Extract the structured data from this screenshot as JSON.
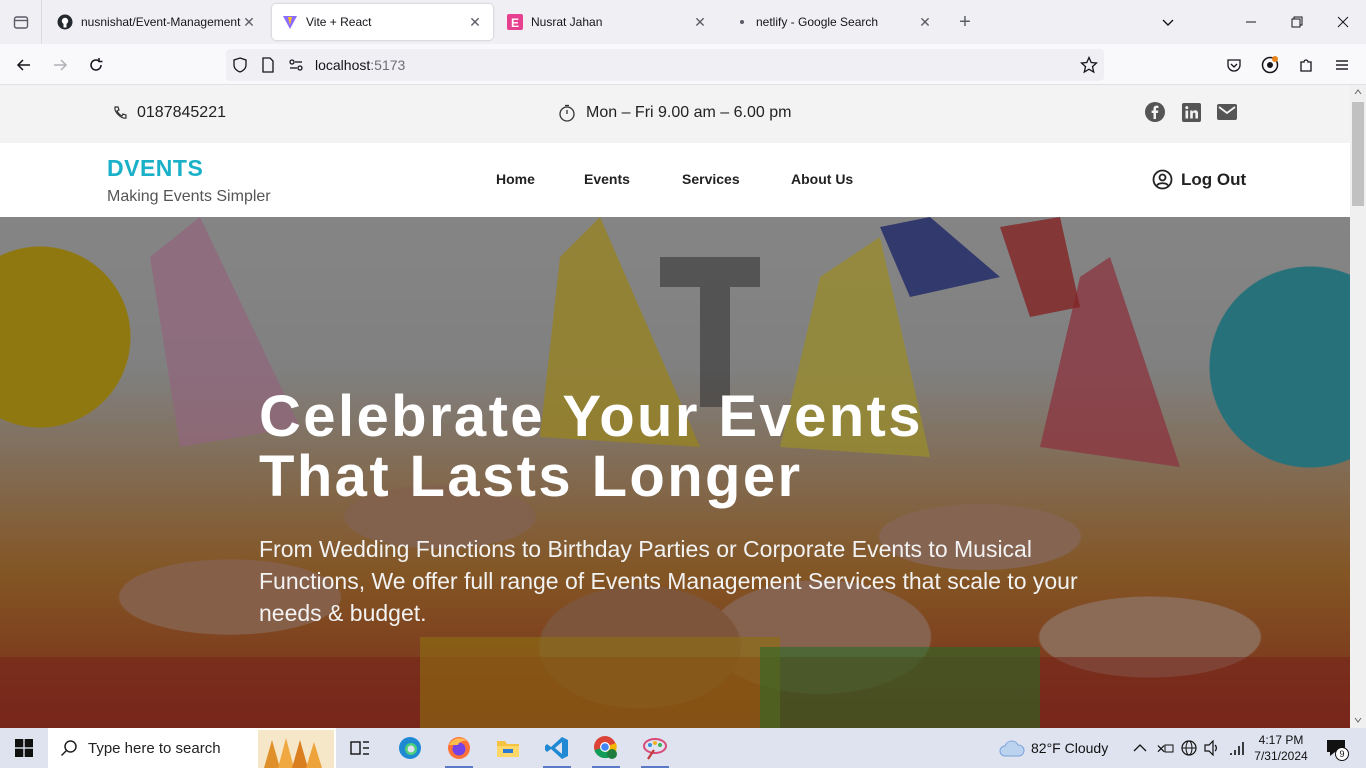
{
  "browser": {
    "tabs": [
      {
        "title": "nusnishat/Event-Management",
        "favicon": "github-icon",
        "active": false
      },
      {
        "title": "Vite + React",
        "favicon": "vite-icon",
        "active": true
      },
      {
        "title": "Nusrat Jahan",
        "favicon": "e-letter-icon",
        "active": false
      },
      {
        "title": "netlify - Google Search",
        "favicon": "dot-icon",
        "active": false
      }
    ],
    "url_host": "localhost",
    "url_port": ":5173"
  },
  "topbar": {
    "phone": "0187845221",
    "hours": "Mon – Fri 9.00 am – 6.00 pm"
  },
  "header": {
    "brand": "DVENTS",
    "tagline": "Making Events Simpler",
    "nav": [
      "Home",
      "Events",
      "Services",
      "About Us"
    ],
    "logout": "Log Out"
  },
  "hero": {
    "title_line1": "Celebrate Your Events",
    "title_line2": "That Lasts Longer",
    "description": "From Wedding Functions to Birthday Parties or Corporate Events to Musical Functions, We offer full range of Events Management Services that scale to your needs & budget."
  },
  "taskbar": {
    "search_placeholder": "Type here to search",
    "weather": "82°F  Cloudy",
    "time": "4:17 PM",
    "date": "7/31/2024",
    "notifications": "9"
  },
  "colors": {
    "brand": "#1ab0c8",
    "topstrip": "#f3f3f3",
    "taskbar": "#dfe3f0"
  }
}
